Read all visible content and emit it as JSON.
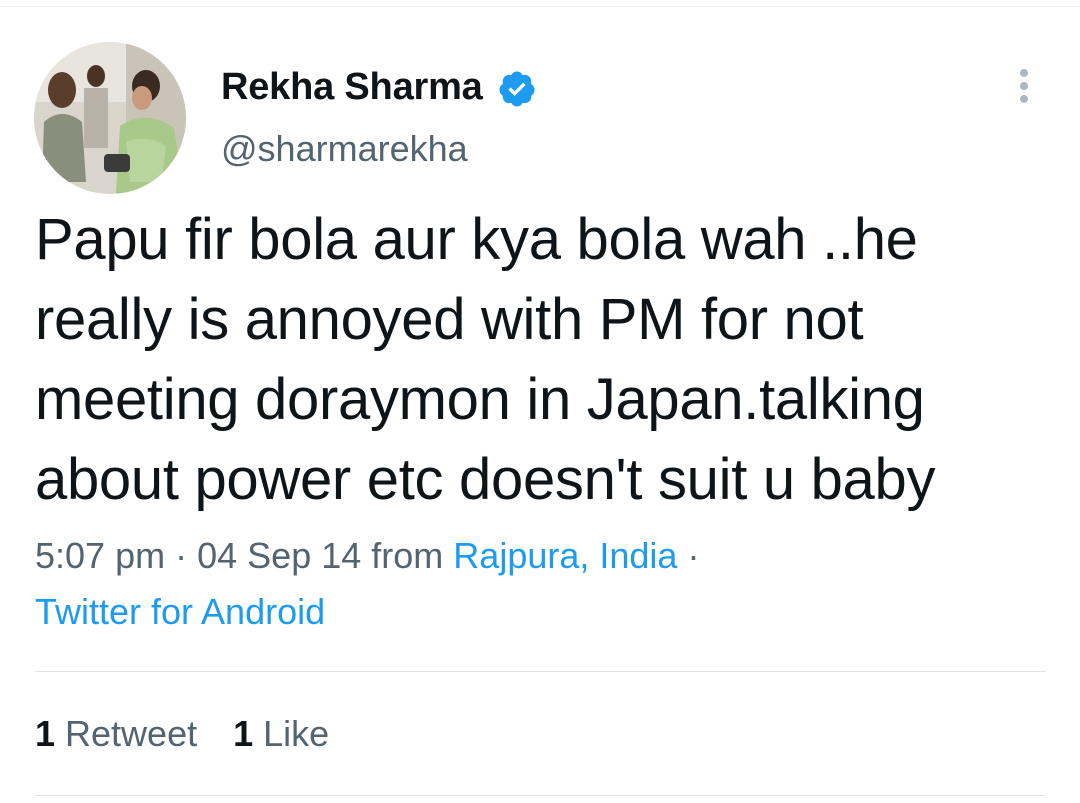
{
  "author": {
    "name": "Rekha Sharma",
    "handle": "@sharmarekha",
    "verified": true,
    "verified_color": "#1d9bf0"
  },
  "tweet": {
    "lines": [
      "Papu fir bola aur kya bola wah ..he",
      "really is annoyed with PM for not",
      "meeting doraymon in Japan.talking",
      "about power etc doesn't suit u baby"
    ]
  },
  "meta": {
    "time": "5:07 pm",
    "separator": "·",
    "date": "04 Sep 14",
    "from_label": "from",
    "location": "Rajpura, India",
    "source": "Twitter for Android"
  },
  "stats": {
    "retweets_count": "1",
    "retweets_label": "Retweet",
    "likes_count": "1",
    "likes_label": "Like"
  },
  "icons": {
    "more": "more-vertical-icon",
    "verified": "verified-badge-icon"
  }
}
